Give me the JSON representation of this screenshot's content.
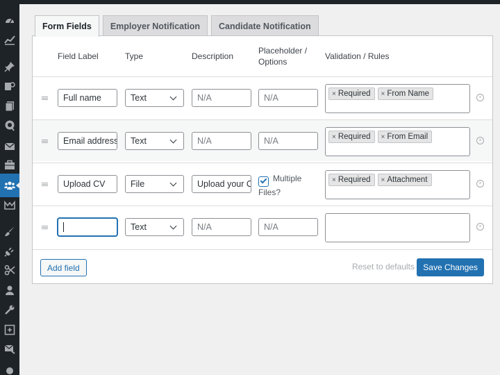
{
  "tabs": [
    {
      "label": "Form Fields",
      "active": true
    },
    {
      "label": "Employer Notification",
      "active": false
    },
    {
      "label": "Candidate Notification",
      "active": false
    }
  ],
  "table": {
    "headers": {
      "label": "Field Label",
      "type": "Type",
      "description": "Description",
      "placeholder_line1": "Placeholder /",
      "placeholder_line2": "Options",
      "rules": "Validation / Rules"
    },
    "rows": [
      {
        "label": "Full name",
        "type": "Text",
        "description": "N/A",
        "placeholder": "N/A",
        "rules": [
          "Required",
          "From Name"
        ]
      },
      {
        "label": "Email address",
        "type": "Text",
        "description": "N/A",
        "placeholder": "N/A",
        "rules": [
          "Required",
          "From Email"
        ]
      },
      {
        "label": "Upload CV",
        "type": "File",
        "description": "Upload your CV",
        "multiple_line1": "Multiple",
        "multiple_line2": "Files?",
        "multiple_checked": true,
        "rules": [
          "Required",
          "Attachment"
        ]
      },
      {
        "label": "",
        "type": "Text",
        "description": "N/A",
        "placeholder": "N/A",
        "rules": []
      }
    ],
    "chip_remove_glyph": "×",
    "row_remove_glyph": "×"
  },
  "footer": {
    "add_field": "Add field",
    "reset": "Reset to defaults",
    "save": "Save Changes"
  },
  "sidebar": {
    "icons": [
      "dashboard-icon",
      "analytics-icon",
      "pin-icon",
      "media-icon",
      "pages-icon",
      "comments-icon",
      "mail-icon",
      "briefcase-icon",
      "users-group-icon",
      "chart-icon",
      "brush-icon",
      "plugin-icon",
      "tools-icon",
      "user-icon",
      "wrench-icon",
      "settings-icon",
      "envelope-icon",
      "circle-icon"
    ],
    "active": "users-group-icon"
  },
  "colors": {
    "accent": "#2271b1",
    "sidebar": "#1d2327",
    "background": "#f0f0f1"
  }
}
